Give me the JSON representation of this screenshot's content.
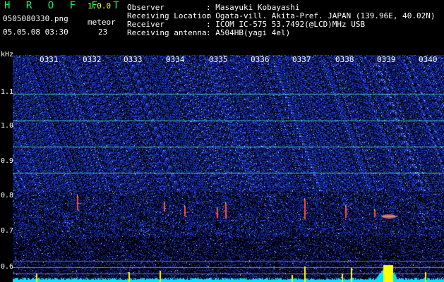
{
  "header": {
    "app_title": "H R O F F T",
    "app_version": "1.0.0",
    "filename": "0505080330.png",
    "meteor_label": "meteor",
    "datetime": "05.05.08 03:30",
    "meteor_count": "23"
  },
  "info": [
    {
      "key": "Observer",
      "value": ": Masayuki Kobayashi"
    },
    {
      "key": "Receiving Location",
      "value": ": Ogata-vill. Akita-Pref. JAPAN (139.96E, 40.02N)"
    },
    {
      "key": "Receiver",
      "value": ": ICOM IC-575 53.7492(@LCD)MHz USB"
    },
    {
      "key": "Receiving antenna",
      "value": ": A504HB(yagi 4el)"
    }
  ],
  "axis": {
    "unit": "kHz",
    "y_ticks": [
      "1.1",
      "1.0",
      "0.9",
      "0.8",
      "0.7",
      "0.6"
    ],
    "time_ticks": [
      "0331",
      "0332",
      "0333",
      "0334",
      "0335",
      "0336",
      "0337",
      "0338",
      "0339",
      "0340"
    ]
  },
  "colors": {
    "background": "#000000",
    "noise_blue": "#1a2bd6",
    "carrier_line": "#4dd9ff",
    "meteor_echo": "#ff3333",
    "bottom_spectrum": "#00e5ff",
    "spectrum_peaks": "#ffff00"
  }
}
